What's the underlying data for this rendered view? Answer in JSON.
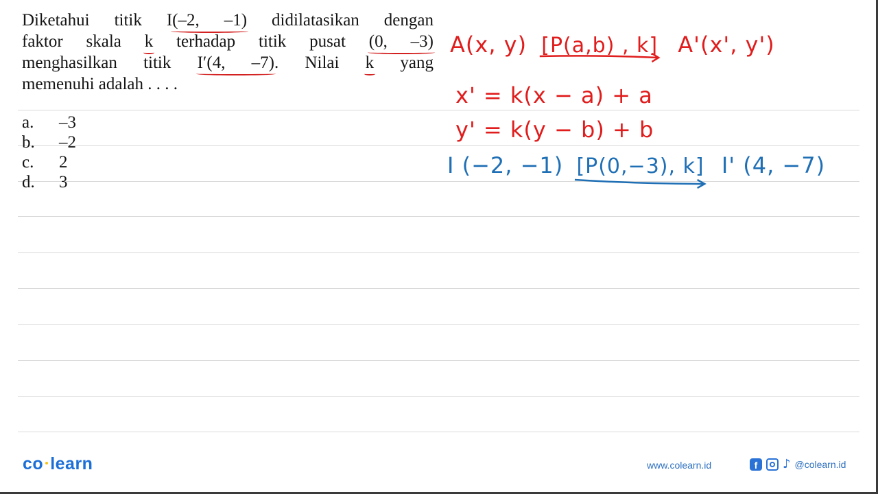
{
  "question": {
    "lines": [
      [
        "Diketahui titik I",
        "(–2, –1)",
        " didilatasikan dengan"
      ],
      [
        "faktor skala ",
        "k",
        " terhadap titik pusat ",
        "(0, –3)"
      ],
      [
        "menghasilkan titik ",
        "I′(4, –7)",
        ". Nilai ",
        "k",
        " yang"
      ],
      [
        "memenuhi adalah . . . ."
      ]
    ],
    "full_text": "Diketahui titik I(–2, –1) didilatasikan dengan faktor skala k terhadap titik pusat (0, –3) menghasilkan titik I′(4, –7). Nilai k yang memenuhi adalah . . . ."
  },
  "options": [
    {
      "letter": "a.",
      "value": "–3"
    },
    {
      "letter": "b.",
      "value": "–2"
    },
    {
      "letter": "c.",
      "value": "2"
    },
    {
      "letter": "d.",
      "value": "3"
    }
  ],
  "handwriting": {
    "rule_source": "A(x, y)",
    "rule_label": "[P(a,b) , k]",
    "rule_target": "A'(x', y')",
    "eq_x": "x' = k(x − a) + a",
    "eq_y": "y' = k(y − b) + b",
    "apply_source": "I (−2, −1)",
    "apply_label": "[P(0,−3), k]",
    "apply_target": "I' (4, −7)",
    "colors": {
      "red": "#e01c1c",
      "blue": "#1f6fb5"
    }
  },
  "footer": {
    "logo_left": "co",
    "logo_right": "learn",
    "url": "www.colearn.id",
    "social_icons": [
      "facebook-icon",
      "instagram-icon",
      "tiktok-icon"
    ],
    "fb_glyph": "f",
    "tt_glyph": "♪",
    "handle": "@colearn.id",
    "brand_color": "#1b6fd6"
  }
}
